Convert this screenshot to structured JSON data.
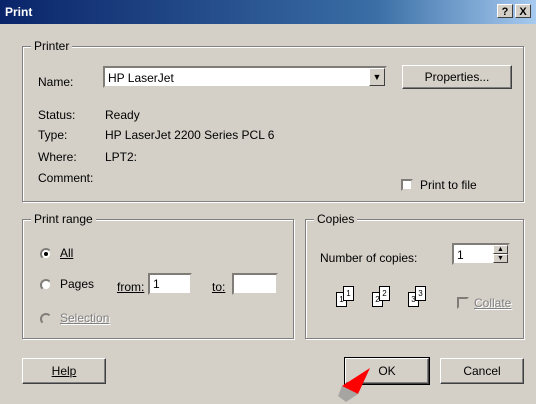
{
  "window": {
    "title": "Print",
    "help_btn": "?",
    "close_btn": "X"
  },
  "printer": {
    "group_label": "Printer",
    "name_label": "Name:",
    "name_value": "HP LaserJet",
    "properties_label": "Properties...",
    "status_label": "Status:",
    "status_value": "Ready",
    "type_label": "Type:",
    "type_value": "HP LaserJet 2200 Series PCL 6",
    "where_label": "Where:",
    "where_value": "LPT2:",
    "comment_label": "Comment:",
    "print_to_file_label": "Print to file"
  },
  "print_range": {
    "group_label": "Print range",
    "all_label": "All",
    "pages_label": "Pages",
    "from_label": "from:",
    "from_value": "1",
    "to_label": "to:",
    "to_value": "",
    "selection_label": "Selection"
  },
  "copies": {
    "group_label": "Copies",
    "number_label": "Number of copies:",
    "number_value": "1",
    "collate_label": "Collate",
    "page_numbers": [
      "1",
      "1",
      "2",
      "2",
      "3",
      "3"
    ]
  },
  "buttons": {
    "help": "Help",
    "ok": "OK",
    "cancel": "Cancel"
  },
  "colors": {
    "face": "#d4d0c8",
    "title_start": "#0a246a",
    "pointer": "#ff0000"
  }
}
